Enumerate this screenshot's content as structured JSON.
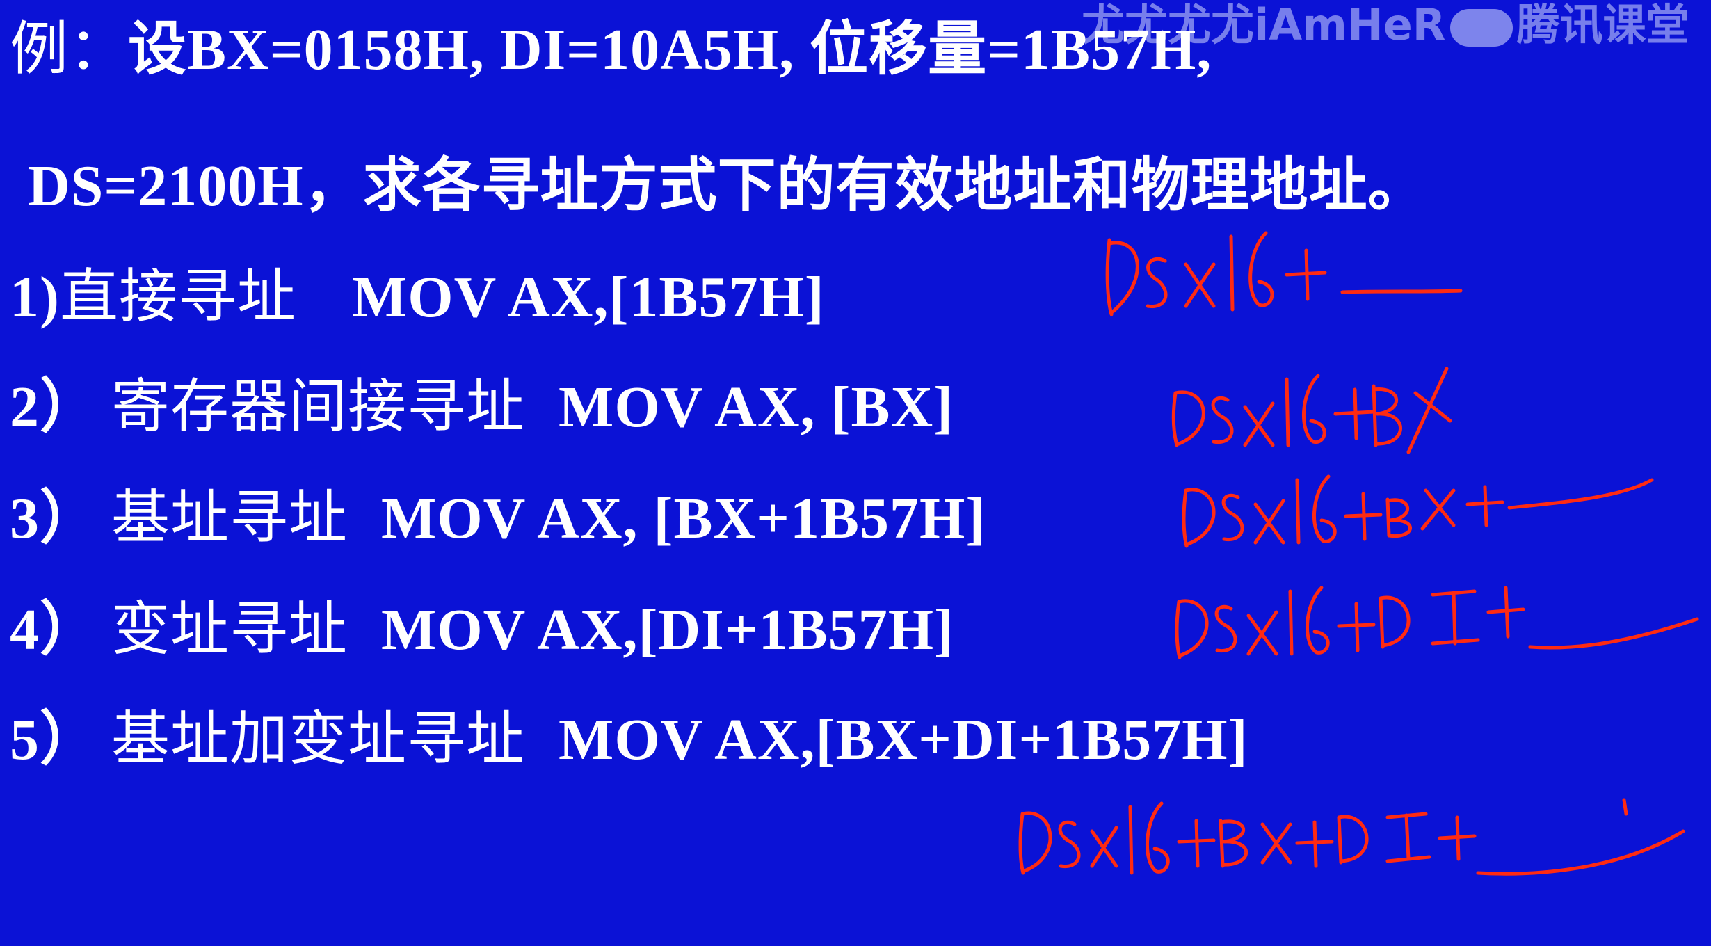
{
  "watermark": {
    "text_left": "尤尤尤尤iAmHeR",
    "text_right": "腾讯课堂"
  },
  "problem": {
    "line1_prefix": "例：",
    "line1_body": "设BX=0158H, DI=10A5H, 位移量=1B57H,",
    "line2": "DS=2100H，求各寻址方式下的有效地址和物理地址。"
  },
  "items": [
    {
      "num": "1)",
      "mode": "直接寻址",
      "instr": "MOV  AX,[1B57H]"
    },
    {
      "num": "2）",
      "mode": "寄存器间接寻址",
      "instr": "MOV  AX, [BX]"
    },
    {
      "num": "3）",
      "mode": "基址寻址",
      "instr": "MOV  AX, [BX+1B57H]"
    },
    {
      "num": "4）",
      "mode": "变址寻址",
      "instr": "MOV  AX,[DI+1B57H]"
    },
    {
      "num": "5）",
      "mode": "基址加变址寻址",
      "instr": "MOV  AX,[BX+DI+1B57H]"
    }
  ],
  "handwriting": [
    {
      "text": "DSx16+ ___"
    },
    {
      "text": "DSx16+BX"
    },
    {
      "text": "DSx16+BX+ ___"
    },
    {
      "text": "DSx16+DI+ ___"
    },
    {
      "text": "DSx16+BX+DI+ ___"
    }
  ],
  "colors": {
    "background": "#0b12d6",
    "text": "#ffffff",
    "ink": "#ff2a12"
  }
}
